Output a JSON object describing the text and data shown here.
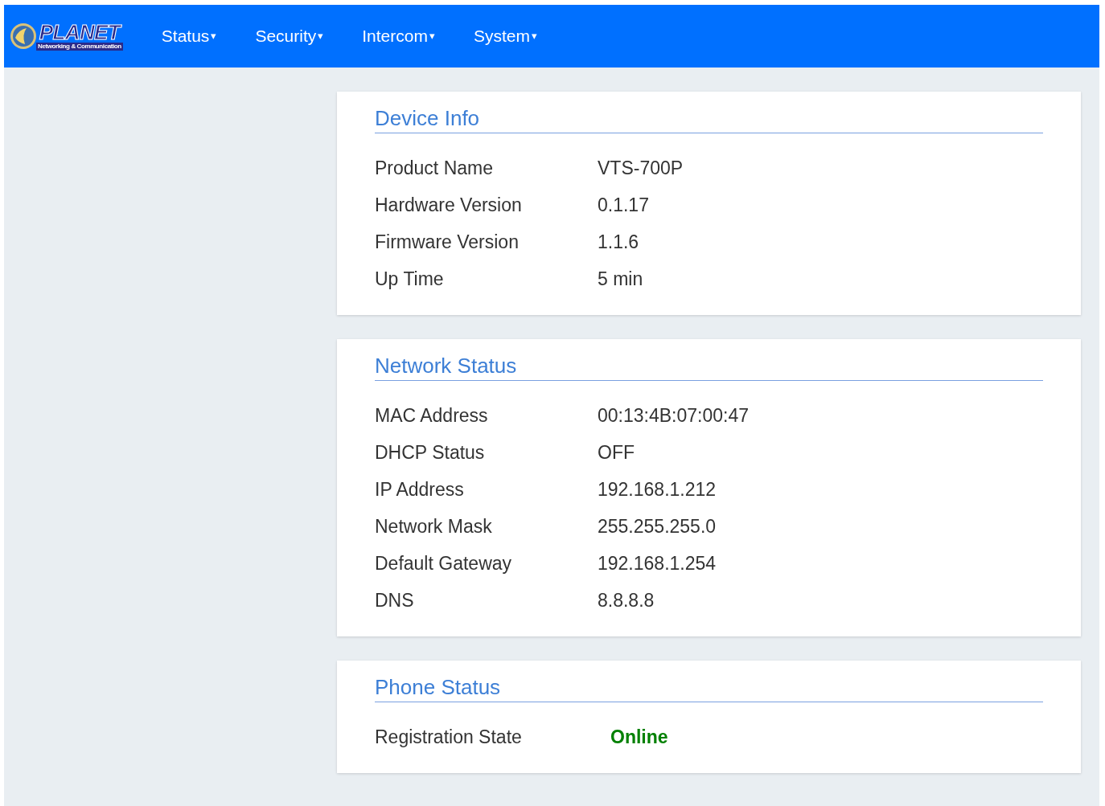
{
  "logo": {
    "name": "PLANET",
    "tagline": "Networking & Communication"
  },
  "nav": [
    {
      "label": "Status",
      "caret": "▾"
    },
    {
      "label": "Security",
      "caret": "▾"
    },
    {
      "label": "Intercom",
      "caret": "▾"
    },
    {
      "label": "System",
      "caret": "▾"
    }
  ],
  "panels": [
    {
      "title": "Device Info",
      "rows": [
        {
          "label": "Product Name",
          "value": "VTS-700P",
          "kind": "plain"
        },
        {
          "label": "Hardware Version",
          "value": "0.1.17",
          "kind": "plain"
        },
        {
          "label": "Firmware Version",
          "value": "1.1.6",
          "kind": "plain"
        },
        {
          "label": "Up Time",
          "value": "5 min",
          "kind": "plain"
        }
      ]
    },
    {
      "title": "Network Status",
      "rows": [
        {
          "label": "MAC Address",
          "value": "00:13:4B:07:00:47",
          "kind": "plain"
        },
        {
          "label": "DHCP Status",
          "value": "OFF",
          "kind": "plain"
        },
        {
          "label": "IP Address",
          "value": "192.168.1.212",
          "kind": "plain"
        },
        {
          "label": "Network Mask",
          "value": "255.255.255.0",
          "kind": "plain"
        },
        {
          "label": "Default Gateway",
          "value": "192.168.1.254",
          "kind": "plain"
        },
        {
          "label": "DNS",
          "value": "8.8.8.8",
          "kind": "plain"
        }
      ]
    },
    {
      "title": "Phone Status",
      "rows": [
        {
          "label": "Registration State",
          "value": "Online",
          "kind": "status",
          "color": "#008000"
        }
      ]
    }
  ]
}
